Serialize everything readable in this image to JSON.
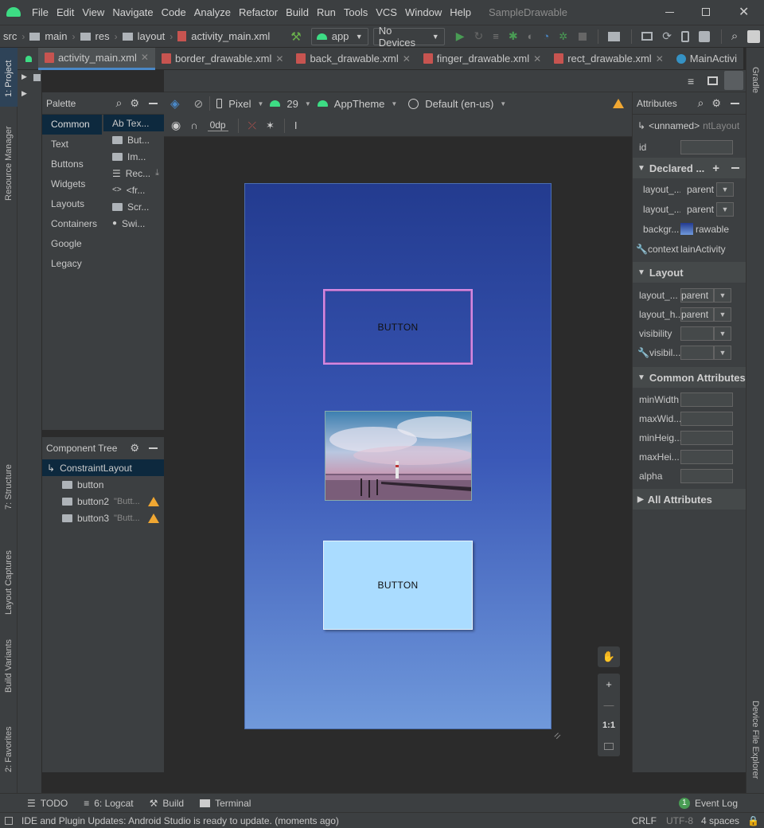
{
  "menu": [
    "File",
    "Edit",
    "View",
    "Navigate",
    "Code",
    "Analyze",
    "Refactor",
    "Build",
    "Run",
    "Tools",
    "VCS",
    "Window",
    "Help"
  ],
  "window_title": "SampleDrawable",
  "breadcrumb": [
    "src",
    "main",
    "res",
    "layout",
    "activity_main.xml"
  ],
  "run_config": "app",
  "device": "No Devices",
  "tabs": [
    "activity_main.xml",
    "border_drawable.xml",
    "back_drawable.xml",
    "finger_drawable.xml",
    "rect_drawable.xml",
    "MainActivi"
  ],
  "palette": {
    "title": "Palette",
    "categories": [
      "Common",
      "Text",
      "Buttons",
      "Widgets",
      "Layouts",
      "Containers",
      "Google",
      "Legacy"
    ],
    "items": [
      "Ab Tex...",
      "But...",
      "Im...",
      "Rec...",
      "<fr...",
      "Scr...",
      "Swi..."
    ]
  },
  "toolbar": {
    "device": "Pixel",
    "api": "29",
    "theme": "AppTheme",
    "locale": "Default (en-us)",
    "margin": "0dp"
  },
  "component_tree": {
    "title": "Component Tree",
    "root": "ConstraintLayout",
    "children": [
      {
        "name": "button",
        "hint": ""
      },
      {
        "name": "button2",
        "hint": "\"Butt..."
      },
      {
        "name": "button3",
        "hint": "\"Butt..."
      }
    ]
  },
  "design": {
    "button1": "BUTTON",
    "button3": "BUTTON"
  },
  "zoom": {
    "ratio": "1:1",
    "plus": "+",
    "minus": "—"
  },
  "attributes": {
    "title": "Attributes",
    "header": "<unnamed>",
    "header_type": "ntLayout",
    "id_label": "id",
    "declared": {
      "title": "Declared ...",
      "rows": [
        {
          "label": "layout_...",
          "value": "parent"
        },
        {
          "label": "layout_...",
          "value": "parent"
        },
        {
          "label": "backgr...",
          "value": "rawable"
        },
        {
          "label": "context",
          "value": "lainActivity"
        }
      ]
    },
    "layout": {
      "title": "Layout",
      "rows": [
        {
          "label": "layout_...",
          "value": "parent"
        },
        {
          "label": "layout_h...",
          "value": "parent"
        },
        {
          "label": "visibility",
          "value": ""
        },
        {
          "label": "visibil...",
          "value": ""
        }
      ]
    },
    "common": {
      "title": "Common Attributes",
      "rows": [
        "minWidth",
        "maxWid...",
        "minHeig...",
        "maxHei...",
        "alpha"
      ]
    },
    "all": "All Attributes"
  },
  "left_tools": [
    "1: Project",
    "Resource Manager",
    "7: Structure",
    "Layout Captures",
    "Build Variants",
    "2: Favorites"
  ],
  "right_tools": [
    "Gradle",
    "Device File Explorer"
  ],
  "bottom": {
    "todo": "TODO",
    "logcat": "6: Logcat",
    "build": "Build",
    "terminal": "Terminal",
    "event_log": "Event Log",
    "event_count": "1"
  },
  "status": {
    "message": "IDE and Plugin Updates: Android Studio is ready to update. (moments ago)",
    "line_sep": "CRLF",
    "encoding": "UTF-8",
    "indent": "4 spaces"
  },
  "colors": {
    "accent": "#4a88c7",
    "android_green": "#3ddc84",
    "warning": "#f0a732"
  }
}
